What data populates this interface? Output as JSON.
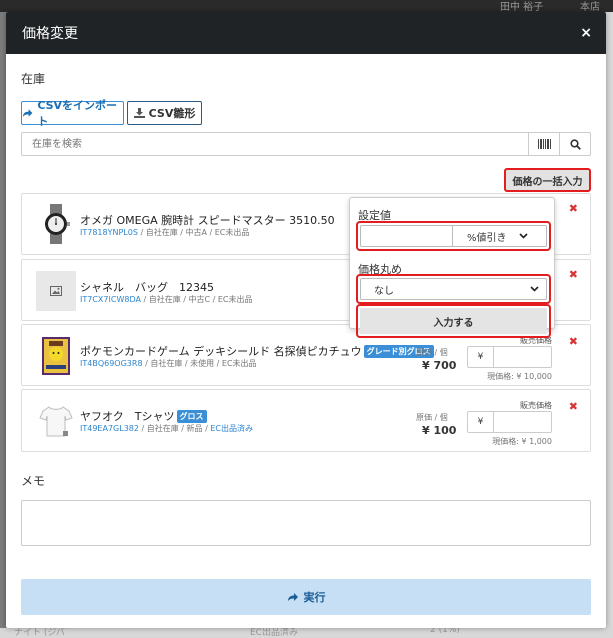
{
  "background": {
    "top_user": "田中 裕子",
    "top_right": "本店",
    "bottom_left": "ナイト (ジバ",
    "bottom_mid": "EC出品済み",
    "bottom_right": "2 (1%)"
  },
  "modal": {
    "title": "価格変更",
    "close": "×"
  },
  "inventory": {
    "section_label": "在庫",
    "csv_import_label": "CSVをインポート",
    "csv_template_label": "CSV雛形",
    "search_placeholder": "在庫を検索",
    "bulk_button_label": "価格の一括入力"
  },
  "bulk_popup": {
    "setting_label": "設定値",
    "setting_value": "",
    "discount_option": "%値引き",
    "rounding_label": "価格丸め",
    "rounding_option": "なし",
    "apply_label": "入力する"
  },
  "items": [
    {
      "name": "オメガ OMEGA 腕時計 スピードマスター 3510.50",
      "code": "IT7818YNPL0S",
      "meta": " / 自社在庫 / 中古A / EC未出品",
      "badge": "",
      "thumb": "watch-thumbnail"
    },
    {
      "name": "シャネル　バッグ　12345",
      "code": "IT7CX7ICW8DA",
      "meta": " / 自社在庫 / 中古C / EC未出品",
      "badge": "",
      "thumb": "image-placeholder-icon"
    },
    {
      "name": "ポケモンカードゲーム デッキシールド 名探偵ピカチュウ",
      "code": "IT4BQ69OG3R8",
      "meta": " / 自社在庫 / 未使用 / EC未出品",
      "badge": "グレード別グロス",
      "cost_label": "原価 / 個",
      "cost_value": "¥ 700",
      "sale_label": "販売価格",
      "yen": "¥",
      "current_price": "現価格: ¥ 10,000",
      "thumb": "pokemon-card-thumbnail"
    },
    {
      "name": "ヤフオク　Tシャツ",
      "code": "IT49EA7GL382",
      "meta": " / 自社在庫 / 新品 / ",
      "ec": "EC出品済み",
      "badge": "グロス",
      "cost_label": "原価 / 個",
      "cost_value": "¥ 100",
      "sale_label": "販売価格",
      "yen": "¥",
      "current_price": "現価格: ¥ 1,000",
      "thumb": "tshirt-thumbnail"
    }
  ],
  "memo": {
    "label": "メモ",
    "value": ""
  },
  "submit": {
    "label": "実行"
  },
  "colors": {
    "accent": "#3a8fd6",
    "highlight_frame": "#e31d1d",
    "delete": "#d83434",
    "submit_bg": "#c6dff4"
  }
}
